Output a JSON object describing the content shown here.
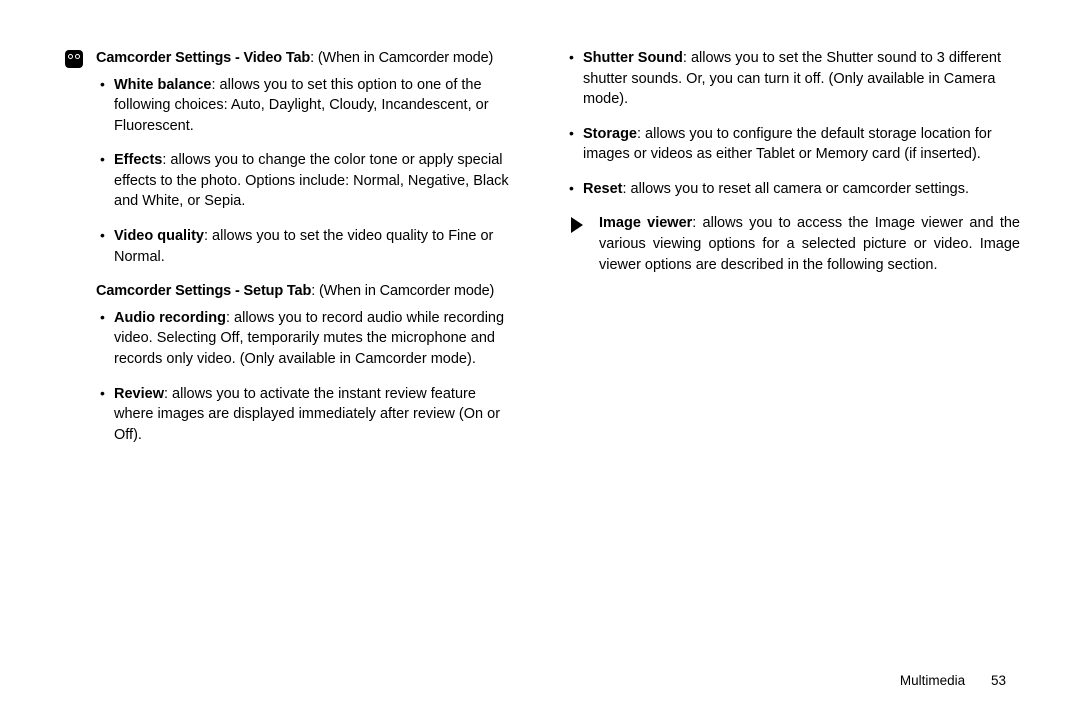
{
  "left": {
    "video": {
      "heading_bold": "Camcorder Settings - Video Tab",
      "heading_rest": ": (When in Camcorder mode)",
      "items": [
        {
          "bold": "White balance",
          "rest": ": allows you to set this option to one of the following choices: Auto, Daylight, Cloudy, Incandescent, or Fluorescent."
        },
        {
          "bold": "Effects",
          "rest": ": allows you to change the color tone or apply special effects to the photo. Options include: Normal, Negative, Black and White, or Sepia."
        },
        {
          "bold": "Video quality",
          "rest": ": allows you to set the video quality to Fine or Normal."
        }
      ]
    },
    "setup": {
      "heading_bold": "Camcorder Settings - Setup Tab",
      "heading_rest": ": (When in Camcorder mode)",
      "items": [
        {
          "bold": "Audio recording",
          "rest": ": allows you to record audio while recording video. Selecting Off, temporarily mutes the microphone and records only video. (Only available in Camcorder mode)."
        },
        {
          "bold": "Review",
          "rest": ": allows you to activate the instant review feature where images are displayed immediately after review (On or Off)."
        }
      ]
    }
  },
  "right": {
    "cont_items": [
      {
        "bold": "Shutter Sound",
        "rest": ": allows you to set the Shutter sound to 3 different shutter sounds. Or, you can turn it off. (Only available in Camera mode)."
      },
      {
        "bold": "Storage",
        "rest": ": allows you to configure the default storage location for images or videos as either Tablet or Memory card (if inserted)."
      },
      {
        "bold": "Reset",
        "rest": ": allows you to reset all camera or camcorder settings."
      }
    ],
    "viewer": {
      "bold": "Image viewer",
      "rest": ": allows you to access the Image viewer and the various viewing options for a selected picture or video. Image viewer options are described in the following section."
    }
  },
  "footer": {
    "section": "Multimedia",
    "page": "53"
  }
}
